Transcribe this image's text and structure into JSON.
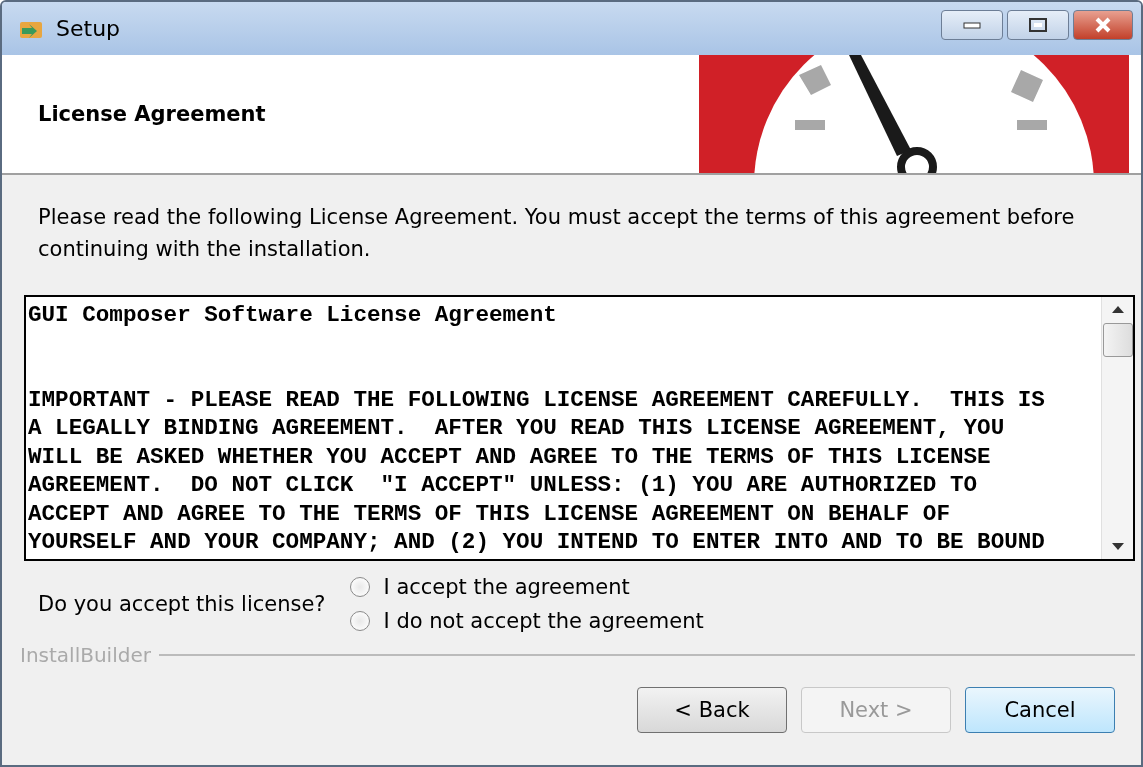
{
  "window": {
    "title": "Setup"
  },
  "header": {
    "title": "License Agreement"
  },
  "intro": "Please read the following License Agreement. You must accept the terms of this agreement before continuing with the installation.",
  "license_text": {
    "title": "GUI Composer Software License Agreement",
    "lines": [
      "IMPORTANT - PLEASE READ THE FOLLOWING LICENSE AGREEMENT CAREFULLY.  THIS IS",
      "A LEGALLY BINDING AGREEMENT.  AFTER YOU READ THIS LICENSE AGREEMENT, YOU",
      "WILL BE ASKED WHETHER YOU ACCEPT AND AGREE TO THE TERMS OF THIS LICENSE",
      "AGREEMENT.  DO NOT CLICK  \"I ACCEPT\" UNLESS: (1) YOU ARE AUTHORIZED TO",
      "ACCEPT AND AGREE TO THE TERMS OF THIS LICENSE AGREEMENT ON BEHALF OF",
      "YOURSELF AND YOUR COMPANY; AND (2) YOU INTEND TO ENTER INTO AND TO BE BOUND"
    ]
  },
  "question": {
    "label": "Do you accept this license?",
    "options": [
      {
        "label": "I accept the agreement",
        "selected": false
      },
      {
        "label": "I do not accept the agreement",
        "selected": false
      }
    ]
  },
  "brand": "InstallBuilder",
  "buttons": [
    {
      "label": "< Back",
      "disabled": false,
      "focused": false
    },
    {
      "label": "Next >",
      "disabled": true,
      "focused": false
    },
    {
      "label": "Cancel",
      "disabled": false,
      "focused": true
    }
  ]
}
